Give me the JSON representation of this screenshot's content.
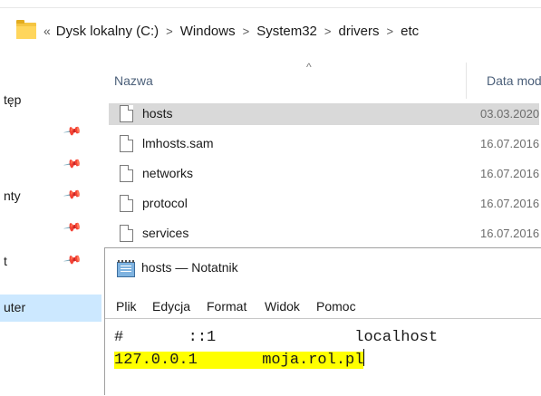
{
  "address_bar": {
    "back_chevron": "«",
    "crumbs": [
      "Dysk lokalny (C:)",
      "Windows",
      "System32",
      "drivers",
      "etc"
    ],
    "separator": ">"
  },
  "nav": {
    "items": [
      {
        "label": "tęp",
        "pinned": false
      },
      {
        "label": "",
        "pinned": true
      },
      {
        "label": "",
        "pinned": true
      },
      {
        "label": "nty",
        "pinned": true
      },
      {
        "label": "",
        "pinned": true
      },
      {
        "label": "t",
        "pinned": true
      },
      {
        "label": "uter",
        "pinned": false,
        "selected": true
      }
    ],
    "pin_glyph": "📌"
  },
  "file_list": {
    "columns": {
      "name": "Nazwa",
      "date": "Data mod"
    },
    "sort_indicator": "^",
    "rows": [
      {
        "name": "hosts",
        "date": "03.03.2020",
        "selected": true
      },
      {
        "name": "lmhosts.sam",
        "date": "16.07.2016"
      },
      {
        "name": "networks",
        "date": "16.07.2016"
      },
      {
        "name": "protocol",
        "date": "16.07.2016"
      },
      {
        "name": "services",
        "date": "16.07.2016"
      }
    ]
  },
  "notepad": {
    "title": "hosts — Notatnik",
    "menu": [
      "Plik",
      "Edycja",
      "Format",
      "Widok",
      "Pomoc"
    ],
    "lines": [
      {
        "text": "#       ::1               localhost",
        "highlighted": false
      },
      {
        "text": "127.0.0.1       moja.rol.pl",
        "highlighted": true
      }
    ],
    "highlight_color": "#ffff00"
  },
  "colors": {
    "folder": "#ffd65c",
    "selected_row": "#d9d9d9",
    "nav_selected": "#cce8ff",
    "header_text": "#4c607a"
  }
}
